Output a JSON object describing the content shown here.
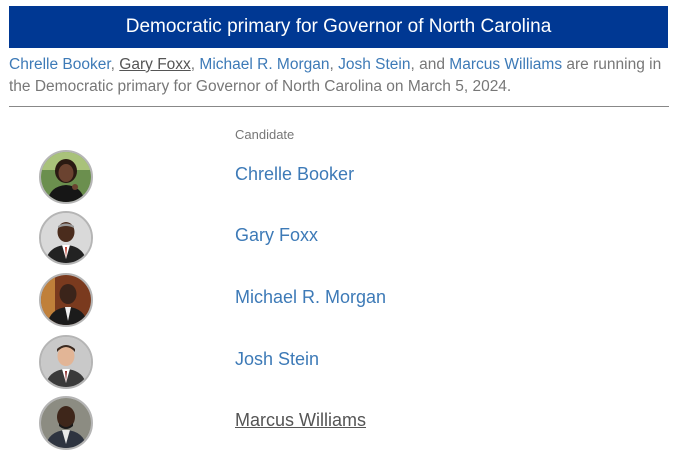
{
  "banner": {
    "title": "Democratic primary for Governor of North Carolina"
  },
  "intro": {
    "names": [
      "Chrelle Booker",
      "Gary Foxx",
      "Michael R. Morgan",
      "Josh Stein",
      "Marcus Williams"
    ],
    "sep": ", ",
    "and": ", and ",
    "suffix": " are running in the Democratic primary for Governor of North Carolina on March 5, 2024."
  },
  "table": {
    "column_header": "Candidate",
    "candidates": [
      {
        "name": "Chrelle Booker",
        "photo": "photo-chrelle-booker"
      },
      {
        "name": "Gary Foxx",
        "photo": "photo-gary-foxx"
      },
      {
        "name": "Michael R. Morgan",
        "photo": "photo-michael-r-morgan"
      },
      {
        "name": "Josh Stein",
        "photo": "photo-josh-stein"
      },
      {
        "name": "Marcus Williams",
        "photo": "photo-marcus-williams"
      }
    ]
  },
  "colors": {
    "banner": "#003893",
    "link": "#3d7ab7",
    "text": "#777777"
  }
}
